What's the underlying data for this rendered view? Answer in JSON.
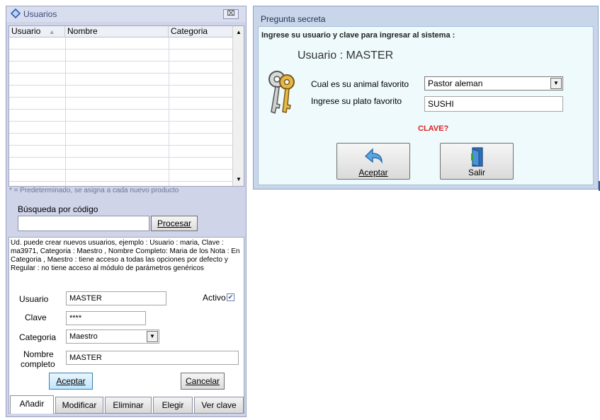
{
  "users_window": {
    "title": "Usuarios",
    "close_label": "⌧",
    "grid": {
      "headers": [
        "Usuario",
        "Nombre",
        "Categoria"
      ],
      "sort_indicator": "▲",
      "row_count": 14
    },
    "default_note": "* = Predeterminado,  se asigna a cada nuevo producto",
    "search": {
      "label": "Búsqueda por código",
      "value": "",
      "button": "Procesar"
    },
    "help_text": "Ud. puede crear nuevos usuarios, ejemplo : Usuario : maria, Clave : ma3971, Categoria : Maestro  , Nombre Completo: Maria de los Nota : En Categoria , Maestro : tiene acceso a todas las opciones por defecto y Regular : no tiene acceso al módulo de parámetros genéricos",
    "form": {
      "usuario_label": "Usuario",
      "usuario_value": "MASTER",
      "activo_label": "Activo",
      "activo_checked": true,
      "clave_label": "Clave",
      "clave_value": "****",
      "categoria_label": "Categoria",
      "categoria_value": "Maestro",
      "nombre_label_1": "Nombre",
      "nombre_label_2": "completo",
      "nombre_value": "MASTER",
      "aceptar": "Aceptar",
      "cancelar": "Cancelar"
    },
    "tabs": [
      "Añadir",
      "Modificar",
      "Eliminar",
      "Elegir",
      "Ver clave"
    ],
    "active_tab": "Añadir"
  },
  "dialog": {
    "title": "Pregunta secreta",
    "instructions": "Ingrese su usuario y clave para ingresar al sistema :",
    "user_line": "Usuario : MASTER",
    "q1_label": "Cual es su animal favorito",
    "q1_value": "Pastor aleman",
    "q2_label": "Ingrese su plato favorito",
    "q2_value": "SUSHI",
    "status": "CLAVE?",
    "aceptar": "Aceptar",
    "salir": "Salir"
  },
  "colors": {
    "status_red": "#e02020",
    "panel_blue": "#cfd4e8",
    "dialog_bg": "#eefafc"
  }
}
